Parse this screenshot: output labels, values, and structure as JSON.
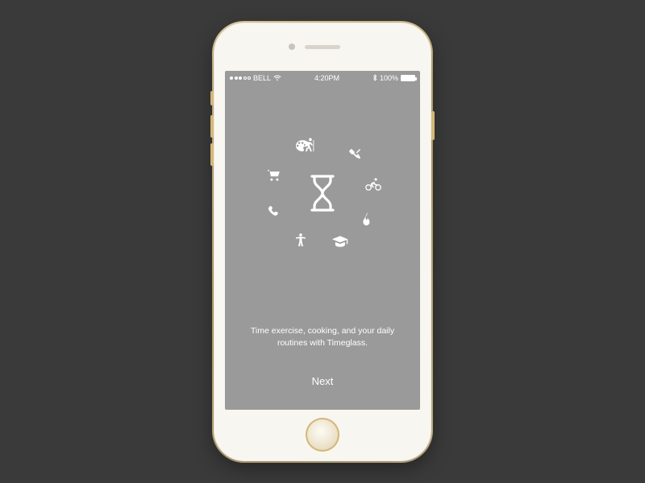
{
  "status": {
    "carrier": "BELL",
    "time": "4:20PM",
    "battery_pct": "100%"
  },
  "onboarding": {
    "tagline": "Time exercise, cooking, and your daily routines with Timeglass.",
    "next_label": "Next"
  },
  "icons": {
    "center": "hourglass-icon",
    "ring": [
      "hiker-icon",
      "utensils-icon",
      "cyclist-icon",
      "flame-icon",
      "graduation-cap-icon",
      "person-icon",
      "phone-icon",
      "cart-icon",
      "palette-icon"
    ]
  }
}
